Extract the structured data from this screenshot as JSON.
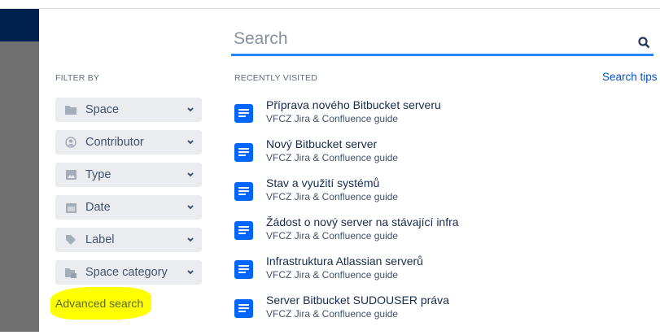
{
  "search": {
    "placeholder": "Search"
  },
  "filter": {
    "heading": "FILTER BY",
    "items": [
      {
        "label": "Space",
        "icon": "folder-icon"
      },
      {
        "label": "Contributor",
        "icon": "user-icon"
      },
      {
        "label": "Type",
        "icon": "image-icon"
      },
      {
        "label": "Date",
        "icon": "calendar-icon"
      },
      {
        "label": "Label",
        "icon": "tag-icon"
      },
      {
        "label": "Space category",
        "icon": "space-category-icon"
      }
    ],
    "advanced": "Advanced search"
  },
  "recent": {
    "heading": "RECENTLY VISITED",
    "tips": "Search tips",
    "items": [
      {
        "title": "Příprava nového Bitbucket serveru",
        "space": "VFCZ Jira & Confluence guide"
      },
      {
        "title": "Nový Bitbucket server",
        "space": "VFCZ Jira & Confluence guide"
      },
      {
        "title": "Stav a využití systémů",
        "space": "VFCZ Jira & Confluence guide"
      },
      {
        "title": "Žádost o nový server na stávající infra",
        "space": "VFCZ Jira & Confluence guide"
      },
      {
        "title": "Infrastruktura Atlassian serverů",
        "space": "VFCZ Jira & Confluence guide"
      },
      {
        "title": "Server Bitbucket SUDOUSER práva",
        "space": "VFCZ Jira & Confluence guide"
      }
    ]
  },
  "colors": {
    "accent": "#2684ff",
    "doc": "#0065ff",
    "nav": "#00204f"
  }
}
